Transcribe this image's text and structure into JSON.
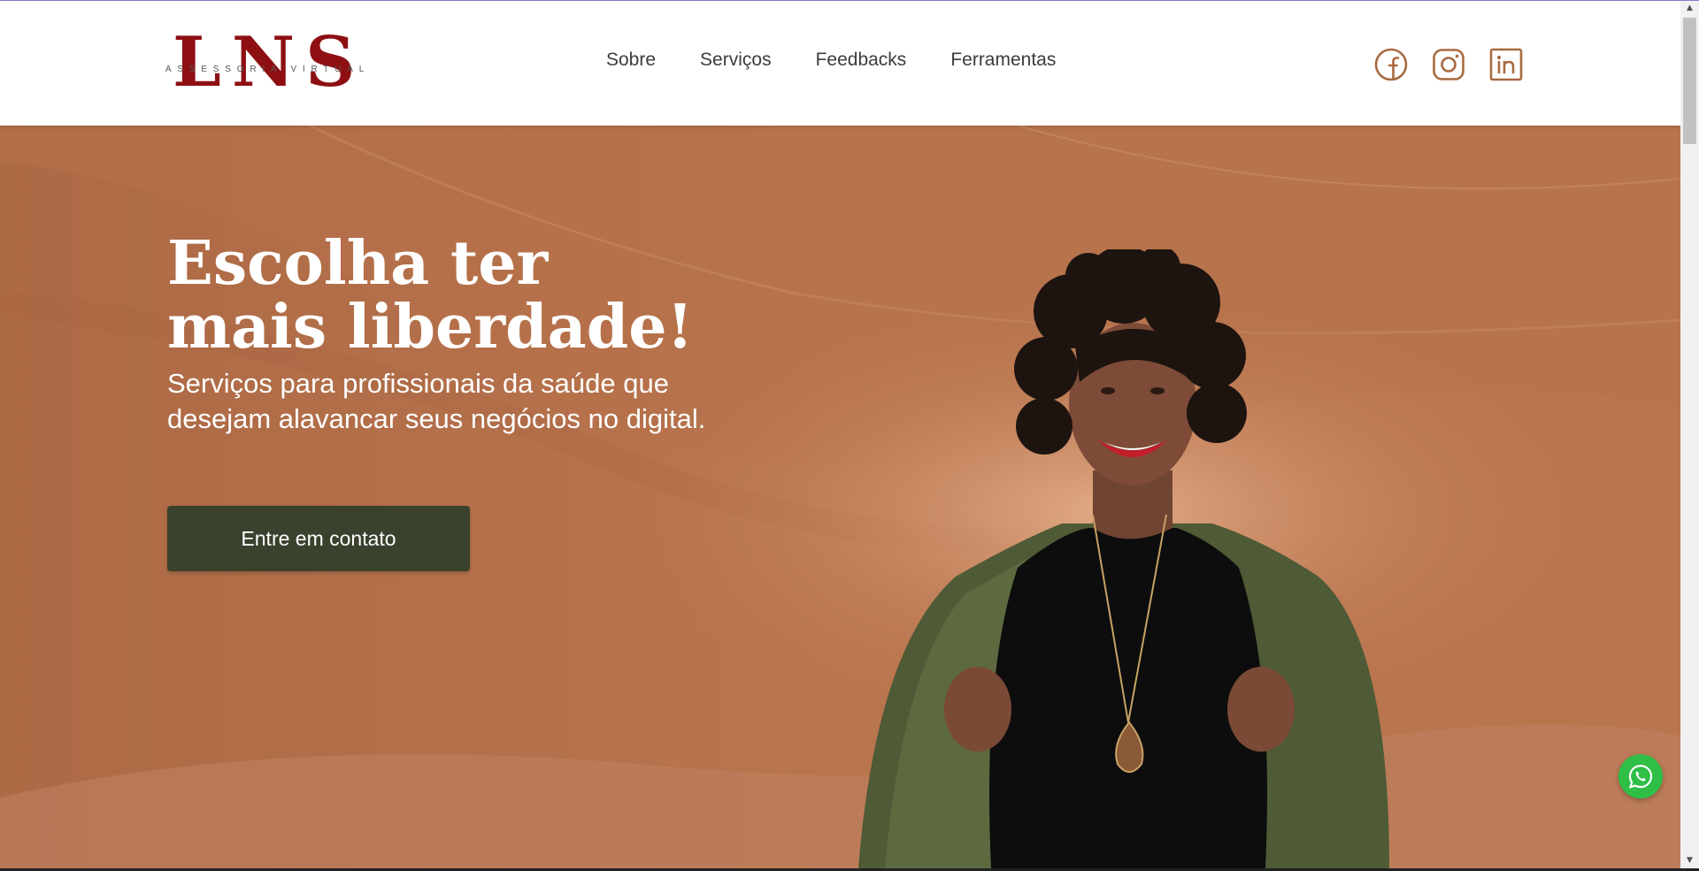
{
  "header": {
    "logo": {
      "mark": "LNS",
      "subtitle": "ASSESSORIA VIRTUAL"
    },
    "nav": [
      {
        "label": "Sobre"
      },
      {
        "label": "Serviços"
      },
      {
        "label": "Feedbacks"
      },
      {
        "label": "Ferramentas"
      }
    ],
    "socials": [
      {
        "icon": "facebook-icon"
      },
      {
        "icon": "instagram-icon"
      },
      {
        "icon": "linkedin-icon"
      }
    ]
  },
  "hero": {
    "title": "Escolha ter mais liberdade!",
    "subtitle": "Serviços para profissionais da saúde que desejam alavancar seus negócios no digital.",
    "cta_label": "Entre em contato"
  },
  "colors": {
    "brand_red": "#8e0f12",
    "hero_bg": "#b9754e",
    "cta_bg": "#3a412d",
    "social_icon": "#a86a40",
    "whatsapp": "#2fbe46"
  },
  "floating": {
    "icon": "whatsapp-icon"
  }
}
